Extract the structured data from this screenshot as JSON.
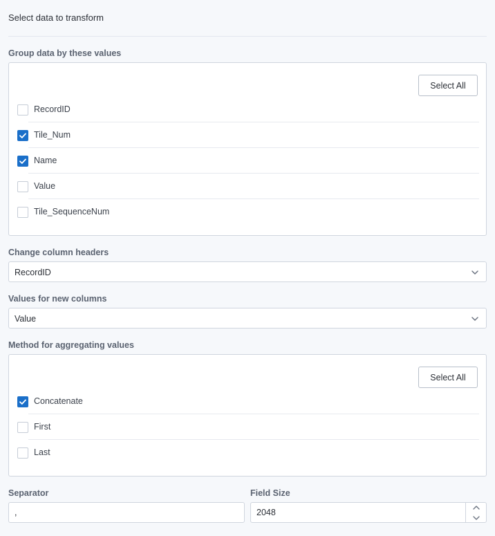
{
  "header": {
    "title": "Select data to transform"
  },
  "group_by": {
    "label": "Group data by these values",
    "select_all_label": "Select All",
    "items": [
      {
        "label": "RecordID",
        "checked": false
      },
      {
        "label": "Tile_Num",
        "checked": true
      },
      {
        "label": "Name",
        "checked": true
      },
      {
        "label": "Value",
        "checked": false
      },
      {
        "label": "Tile_SequenceNum",
        "checked": false
      }
    ]
  },
  "column_headers": {
    "label": "Change column headers",
    "selected": "RecordID"
  },
  "new_column_values": {
    "label": "Values for new columns",
    "selected": "Value"
  },
  "aggregation": {
    "label": "Method for aggregating values",
    "select_all_label": "Select All",
    "items": [
      {
        "label": "Concatenate",
        "checked": true
      },
      {
        "label": "First",
        "checked": false
      },
      {
        "label": "Last",
        "checked": false
      }
    ]
  },
  "separator": {
    "label": "Separator",
    "value": ","
  },
  "field_size": {
    "label": "Field Size",
    "value": "2048"
  },
  "colors": {
    "accent": "#1a6fc9",
    "border": "#cfd5de",
    "background": "#f6f8fb"
  }
}
